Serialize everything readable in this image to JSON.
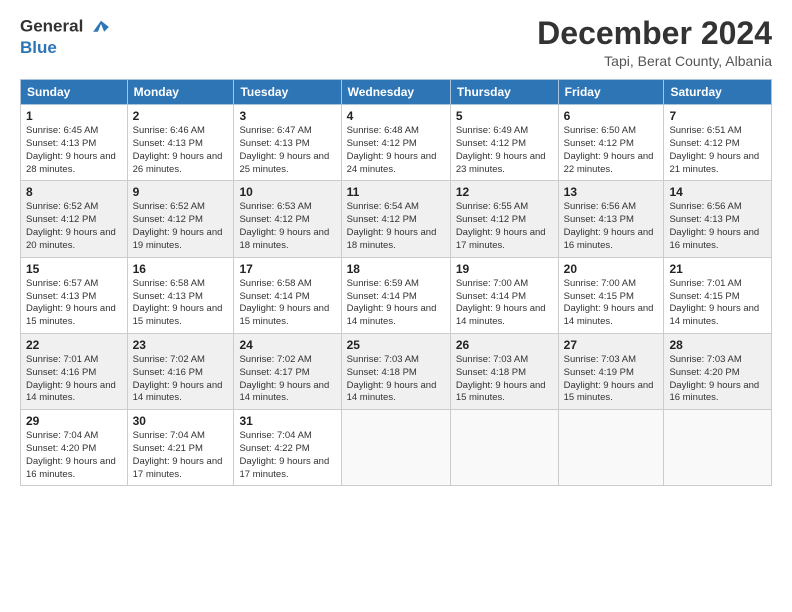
{
  "header": {
    "logo_line1": "General",
    "logo_line2": "Blue",
    "month_title": "December 2024",
    "location": "Tapi, Berat County, Albania"
  },
  "weekdays": [
    "Sunday",
    "Monday",
    "Tuesday",
    "Wednesday",
    "Thursday",
    "Friday",
    "Saturday"
  ],
  "weeks": [
    [
      {
        "day": "1",
        "sunrise": "6:45 AM",
        "sunset": "4:13 PM",
        "daylight": "9 hours and 28 minutes."
      },
      {
        "day": "2",
        "sunrise": "6:46 AM",
        "sunset": "4:13 PM",
        "daylight": "9 hours and 26 minutes."
      },
      {
        "day": "3",
        "sunrise": "6:47 AM",
        "sunset": "4:13 PM",
        "daylight": "9 hours and 25 minutes."
      },
      {
        "day": "4",
        "sunrise": "6:48 AM",
        "sunset": "4:12 PM",
        "daylight": "9 hours and 24 minutes."
      },
      {
        "day": "5",
        "sunrise": "6:49 AM",
        "sunset": "4:12 PM",
        "daylight": "9 hours and 23 minutes."
      },
      {
        "day": "6",
        "sunrise": "6:50 AM",
        "sunset": "4:12 PM",
        "daylight": "9 hours and 22 minutes."
      },
      {
        "day": "7",
        "sunrise": "6:51 AM",
        "sunset": "4:12 PM",
        "daylight": "9 hours and 21 minutes."
      }
    ],
    [
      {
        "day": "8",
        "sunrise": "6:52 AM",
        "sunset": "4:12 PM",
        "daylight": "9 hours and 20 minutes."
      },
      {
        "day": "9",
        "sunrise": "6:52 AM",
        "sunset": "4:12 PM",
        "daylight": "9 hours and 19 minutes."
      },
      {
        "day": "10",
        "sunrise": "6:53 AM",
        "sunset": "4:12 PM",
        "daylight": "9 hours and 18 minutes."
      },
      {
        "day": "11",
        "sunrise": "6:54 AM",
        "sunset": "4:12 PM",
        "daylight": "9 hours and 18 minutes."
      },
      {
        "day": "12",
        "sunrise": "6:55 AM",
        "sunset": "4:12 PM",
        "daylight": "9 hours and 17 minutes."
      },
      {
        "day": "13",
        "sunrise": "6:56 AM",
        "sunset": "4:13 PM",
        "daylight": "9 hours and 16 minutes."
      },
      {
        "day": "14",
        "sunrise": "6:56 AM",
        "sunset": "4:13 PM",
        "daylight": "9 hours and 16 minutes."
      }
    ],
    [
      {
        "day": "15",
        "sunrise": "6:57 AM",
        "sunset": "4:13 PM",
        "daylight": "9 hours and 15 minutes."
      },
      {
        "day": "16",
        "sunrise": "6:58 AM",
        "sunset": "4:13 PM",
        "daylight": "9 hours and 15 minutes."
      },
      {
        "day": "17",
        "sunrise": "6:58 AM",
        "sunset": "4:14 PM",
        "daylight": "9 hours and 15 minutes."
      },
      {
        "day": "18",
        "sunrise": "6:59 AM",
        "sunset": "4:14 PM",
        "daylight": "9 hours and 14 minutes."
      },
      {
        "day": "19",
        "sunrise": "7:00 AM",
        "sunset": "4:14 PM",
        "daylight": "9 hours and 14 minutes."
      },
      {
        "day": "20",
        "sunrise": "7:00 AM",
        "sunset": "4:15 PM",
        "daylight": "9 hours and 14 minutes."
      },
      {
        "day": "21",
        "sunrise": "7:01 AM",
        "sunset": "4:15 PM",
        "daylight": "9 hours and 14 minutes."
      }
    ],
    [
      {
        "day": "22",
        "sunrise": "7:01 AM",
        "sunset": "4:16 PM",
        "daylight": "9 hours and 14 minutes."
      },
      {
        "day": "23",
        "sunrise": "7:02 AM",
        "sunset": "4:16 PM",
        "daylight": "9 hours and 14 minutes."
      },
      {
        "day": "24",
        "sunrise": "7:02 AM",
        "sunset": "4:17 PM",
        "daylight": "9 hours and 14 minutes."
      },
      {
        "day": "25",
        "sunrise": "7:03 AM",
        "sunset": "4:18 PM",
        "daylight": "9 hours and 14 minutes."
      },
      {
        "day": "26",
        "sunrise": "7:03 AM",
        "sunset": "4:18 PM",
        "daylight": "9 hours and 15 minutes."
      },
      {
        "day": "27",
        "sunrise": "7:03 AM",
        "sunset": "4:19 PM",
        "daylight": "9 hours and 15 minutes."
      },
      {
        "day": "28",
        "sunrise": "7:03 AM",
        "sunset": "4:20 PM",
        "daylight": "9 hours and 16 minutes."
      }
    ],
    [
      {
        "day": "29",
        "sunrise": "7:04 AM",
        "sunset": "4:20 PM",
        "daylight": "9 hours and 16 minutes."
      },
      {
        "day": "30",
        "sunrise": "7:04 AM",
        "sunset": "4:21 PM",
        "daylight": "9 hours and 17 minutes."
      },
      {
        "day": "31",
        "sunrise": "7:04 AM",
        "sunset": "4:22 PM",
        "daylight": "9 hours and 17 minutes."
      },
      null,
      null,
      null,
      null
    ]
  ]
}
